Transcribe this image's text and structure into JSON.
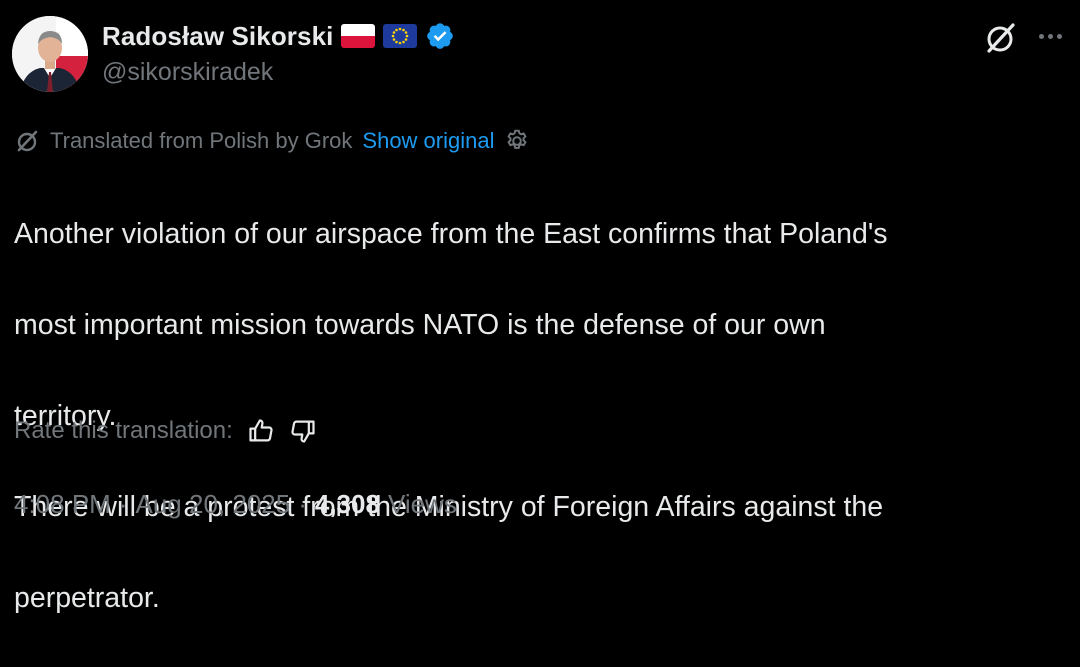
{
  "author": {
    "display_name": "Radosław Sikorski",
    "handle": "@sikorskiradek",
    "flags": [
      "flag-poland-icon",
      "flag-eu-icon"
    ],
    "verified": true
  },
  "translation": {
    "notice": "Translated from Polish by Grok",
    "show_original": "Show original"
  },
  "tweet": {
    "lines": [
      "Another violation of our airspace from the East confirms that Poland's",
      "most important mission towards NATO is the defense of our own",
      "territory.",
      "There will be a protest from the Ministry of Foreign Affairs against the",
      "perpetrator."
    ]
  },
  "rate": {
    "label": "Rate this translation:"
  },
  "meta": {
    "time": "4:08 PM",
    "date": "Aug 20, 2025",
    "separator": "·",
    "views_count": "4,308",
    "views_label": "Views"
  },
  "colors": {
    "background": "#000000",
    "text": "#e7e9ea",
    "muted": "#71767b",
    "accent": "#1d9bf0"
  }
}
